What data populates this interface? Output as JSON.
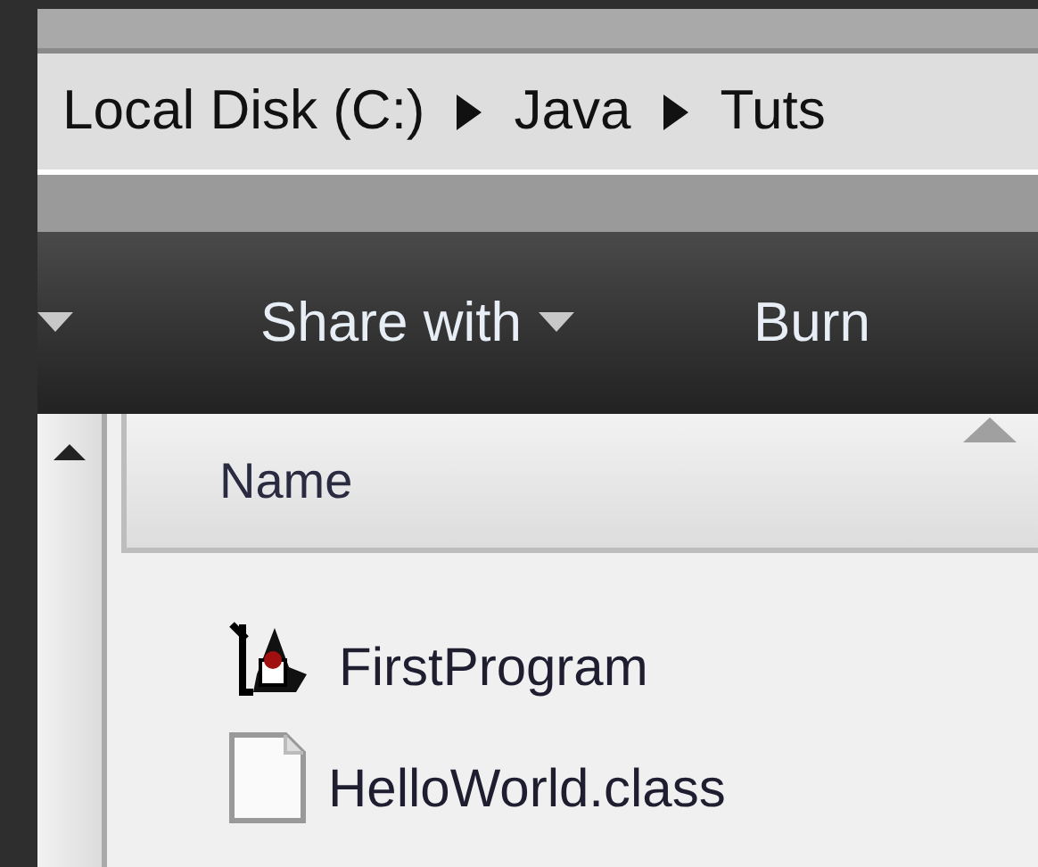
{
  "address_bar": {
    "path": [
      "Local Disk (C:)",
      "Java",
      "Tuts"
    ]
  },
  "toolbar": {
    "items": [
      {
        "label": "Share with",
        "dropdown": true
      },
      {
        "label": "Burn",
        "dropdown": false
      }
    ]
  },
  "file_list": {
    "columns": [
      "Name"
    ],
    "rows": [
      {
        "name": "FirstProgram",
        "kind": "program"
      },
      {
        "name": "HelloWorld.class",
        "kind": "file"
      }
    ]
  }
}
